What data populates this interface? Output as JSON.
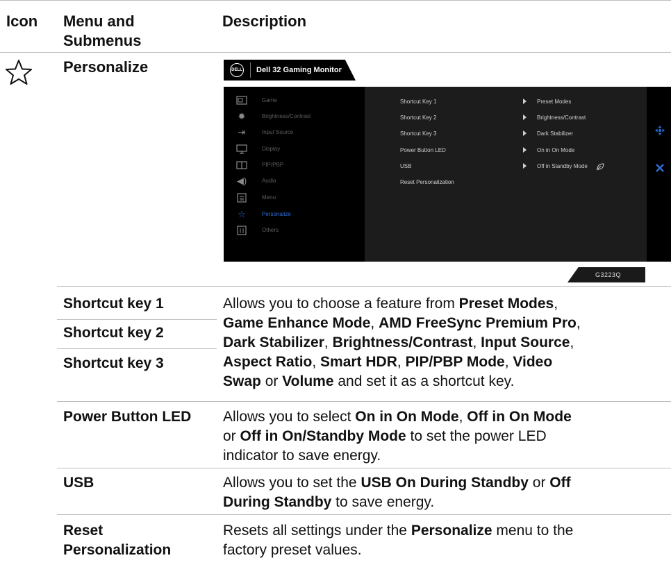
{
  "headers": {
    "icon": "Icon",
    "menu_line1": "Menu and",
    "menu_line2": "Submenus",
    "description": "Description"
  },
  "section": {
    "title": "Personalize",
    "icon": "star-outline-icon"
  },
  "osd": {
    "logo": "DELL",
    "title": "Dell 32 Gaming Monitor",
    "menu_items": [
      {
        "label": "Game",
        "icon": "game-icon"
      },
      {
        "label": "Brightness/Contrast",
        "icon": "brightness-icon"
      },
      {
        "label": "Input Source",
        "icon": "input-source-icon"
      },
      {
        "label": "Display",
        "icon": "display-icon"
      },
      {
        "label": "PIP/PBP",
        "icon": "pip-icon"
      },
      {
        "label": "Audio",
        "icon": "audio-icon"
      },
      {
        "label": "Menu",
        "icon": "menu-icon"
      },
      {
        "label": "Personalize",
        "icon": "star-icon",
        "active": true
      },
      {
        "label": "Others",
        "icon": "others-icon"
      }
    ],
    "submenu": [
      {
        "label": "Shortcut Key 1",
        "value": "Preset Modes"
      },
      {
        "label": "Shortcut Key 2",
        "value": "Brightness/Contrast"
      },
      {
        "label": "Shortcut Key 3",
        "value": "Dark Stabilizer"
      },
      {
        "label": "Power Button LED",
        "value": "On in On Mode"
      },
      {
        "label": "USB",
        "value": "Off in Standby Mode"
      },
      {
        "label": "Reset Personalization",
        "value": ""
      }
    ],
    "nav_icon": "move-arrows-icon",
    "close_icon": "close-icon",
    "model": "G3223Q",
    "accent_color": "#2d6ed4"
  },
  "rows": [
    {
      "labels": [
        "Shortcut key 1",
        "Shortcut key 2",
        "Shortcut key 3"
      ]
    },
    {
      "label": "Power Button LED"
    },
    {
      "label": "USB"
    },
    {
      "label": "Reset Personalization"
    }
  ],
  "desc_shortcut": {
    "t1": "Allows you to choose a feature from ",
    "b1": "Preset Modes",
    "t2": ",",
    "b2": "Game Enhance Mode",
    "t3": ", ",
    "b3": "AMD FreeSync Premium Pro",
    "t4": ",",
    "b4": "Dark Stabilizer",
    "t5": ", ",
    "b5": "Brightness/Contrast",
    "t6": ", ",
    "b6": "Input Source",
    "t7": ",",
    "b7": "Aspect Ratio",
    "t8": ", ",
    "b8": "Smart HDR",
    "t9": ", ",
    "b9": "PIP/PBP Mode",
    "t10": ", ",
    "b10": "Video",
    "b11": "Swap",
    "t11": " or ",
    "b12": "Volume",
    "t12": " and set it as a shortcut key."
  },
  "desc_power": {
    "t1": "Allows you to select ",
    "b1": "On in On Mode",
    "t2": ", ",
    "b2": "Off in On Mode",
    "t3": "or ",
    "b3": "Off in On/Standby Mode",
    "t4": " to set the power LED",
    "t5": "indicator to save energy."
  },
  "desc_usb": {
    "t1": "Allows you to set the ",
    "b1": "USB On During Standby",
    "t2": " or ",
    "b2": "Off",
    "b3": "During Standby",
    "t3": " to save energy."
  },
  "desc_reset": {
    "t1": "Resets all settings under the ",
    "b1": "Personalize",
    "t2": " menu to the",
    "t3": "factory preset values."
  }
}
